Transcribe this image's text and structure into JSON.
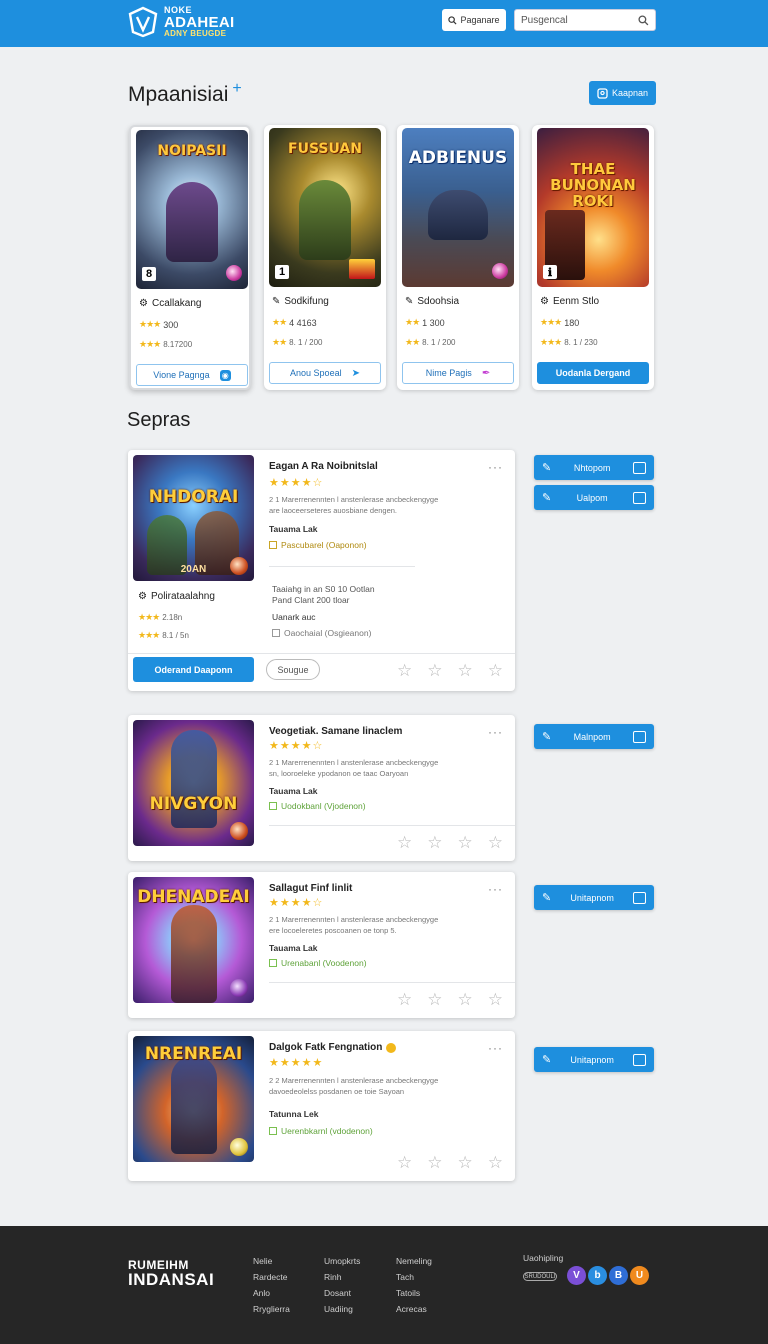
{
  "header": {
    "logo_line1": "NOKE",
    "logo_line2": "ADAHEAI",
    "logo_line3": "ADNY BEUGDE",
    "button_label": "Paganare",
    "search_value": "Pusgencal",
    "brand_color": "#1e8fde"
  },
  "featured": {
    "title": "Mpaanisiai",
    "title_plus": "+",
    "action_label": "Kaapnan",
    "cards": [
      {
        "art_title": "NOIPASII",
        "name": "Ccallakang",
        "rating": "300",
        "stats": "8.17200",
        "stars": "★★★",
        "badge": "8",
        "button": "Vione Pagnga"
      },
      {
        "art_title": "FUSSUAN",
        "name": "Sodkifung",
        "rating": "4 4163",
        "stats": "8. 1 / 200",
        "stars": "★★",
        "badge": "1",
        "button": "Anou Spoeal"
      },
      {
        "art_title": "ADBIENUS",
        "name": "Sdoohsia",
        "rating": "1 300",
        "stats": "8. 1 / 200",
        "stars": "★★",
        "badge": "",
        "button": "Nime Pagis"
      },
      {
        "art_title": "THAE BUNONAN ROKI",
        "name": "Eenm Stlo",
        "rating": "180",
        "stats": "8. 1 / 230",
        "stars": "★★★",
        "badge": "ℹ",
        "button": "Uodanla Dergand"
      }
    ]
  },
  "list": {
    "title": "Sepras",
    "items": [
      {
        "art_title": "NHDORAI",
        "art_sub": "20AN",
        "title": "Eagan A Ra Noibnitslal",
        "stars": "★★★★☆",
        "desc": "2 1 Marerrenennten l anstenlerase ancbeckengyge\nare laoceerseteres auosbiane dengen.",
        "label": "Tauama Lak",
        "meta": "Pascubarel (Oaponon)",
        "sub_name": "Polirataalahng",
        "sub_rating": "2.18n",
        "sub_stats": "8.1 / 5n",
        "note": "Taaiahg in an S0 10 Ootlan\nPand Clant 200 tloar",
        "note2": "Uanark auc",
        "meta2": "Oaochaial (Osgieanon)",
        "primary_button": "Oderand Daaponn",
        "secondary_button": "Sougue",
        "side_buttons": [
          "Nhtopom",
          "Ualpom"
        ]
      },
      {
        "art_title": "NIVGYON",
        "title": "Veogetiak. Samane linaclem",
        "stars": "★★★★☆",
        "desc": "2 1 Marerrenennten l anstenlerase ancbeckengyge\nsn, looroeleke ypodanon oe taac Oaryoan",
        "label": "Tauama Lak",
        "meta": "Uodokbanl (Vjodenon)",
        "side_buttons": [
          "Malnpom"
        ]
      },
      {
        "art_title": "DHENADEAI",
        "title": "Sallagut Finf linlit",
        "stars": "★★★★☆",
        "desc": "2 1 Marerrenennten l anstenlerase ancbeckengyge\nere locoeleretes poscoanen oe tonp 5.",
        "label": "Tauama Lak",
        "meta": "Urenabanl (Voodenon)",
        "side_buttons": [
          "Unitapnom"
        ]
      },
      {
        "art_title": "NRENREAI",
        "title": "Dalgok Fatk Fengnation",
        "stars": "★★★★★",
        "desc": "2 2 Marerrenennten l anstenlerase ancbeckengyge\ndavoedeolelss posdanen oe toie Sayoan",
        "label": "Tatunna Lek",
        "meta": "Uerenbkarnl (vdodenon)",
        "side_buttons": [
          "Unitapnom"
        ]
      }
    ]
  },
  "footer": {
    "brand_line1": "RUMEIHM",
    "brand_line2": "INDANSAI",
    "col1": [
      "Nelie",
      "Rardecte",
      "Anlo",
      "Rryglierra"
    ],
    "col2": [
      "Umopkrts",
      "Rinh",
      "Dosant",
      "Uadiing"
    ],
    "col3": [
      "Nemeling",
      "Tach",
      "Tatoils",
      "Acrecas"
    ],
    "social_title": "Uaohipling",
    "social_pill": "SRUDOULI",
    "social_icons": [
      "V",
      "b",
      "B",
      "U"
    ]
  }
}
